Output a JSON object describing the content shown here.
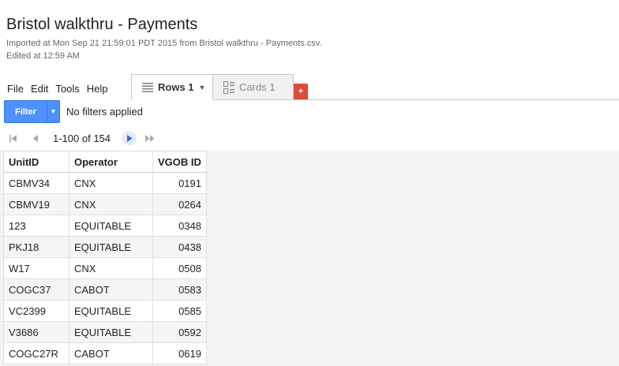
{
  "header": {
    "title": "Bristol walkthru - Payments",
    "imported_line": "Imported at Mon Sep 21 21:59:01 PDT 2015 from Bristol walkthru - Payments.csv.",
    "edited_line": "Edited at 12:59 AM"
  },
  "menu": {
    "items": [
      {
        "label": "File"
      },
      {
        "label": "Edit"
      },
      {
        "label": "Tools"
      },
      {
        "label": "Help"
      }
    ]
  },
  "tabs": [
    {
      "label": "Rows 1",
      "icon": "rows-icon",
      "active": true
    },
    {
      "label": "Cards 1",
      "icon": "cards-icon",
      "active": false
    }
  ],
  "add_tab": {
    "label": "+",
    "color": "#dd4b39"
  },
  "filter": {
    "button_label": "Filter",
    "status": "No filters applied",
    "color": "#4d90fe"
  },
  "pager": {
    "range_text": "1-100 of 154"
  },
  "table": {
    "columns": [
      "UnitID",
      "Operator",
      "VGOB ID"
    ],
    "rows": [
      [
        "CBMV34",
        "CNX",
        "0191"
      ],
      [
        "CBMV19",
        "CNX",
        "0264"
      ],
      [
        "123",
        "EQUITABLE",
        "0348"
      ],
      [
        "PKJ18",
        "EQUITABLE",
        "0438"
      ],
      [
        "W17",
        "CNX",
        "0508"
      ],
      [
        "COGC37",
        "CABOT",
        "0583"
      ],
      [
        "VC2399",
        "EQUITABLE",
        "0585"
      ],
      [
        "V3686",
        "EQUITABLE",
        "0592"
      ],
      [
        "COGC27R",
        "CABOT",
        "0619"
      ]
    ]
  }
}
